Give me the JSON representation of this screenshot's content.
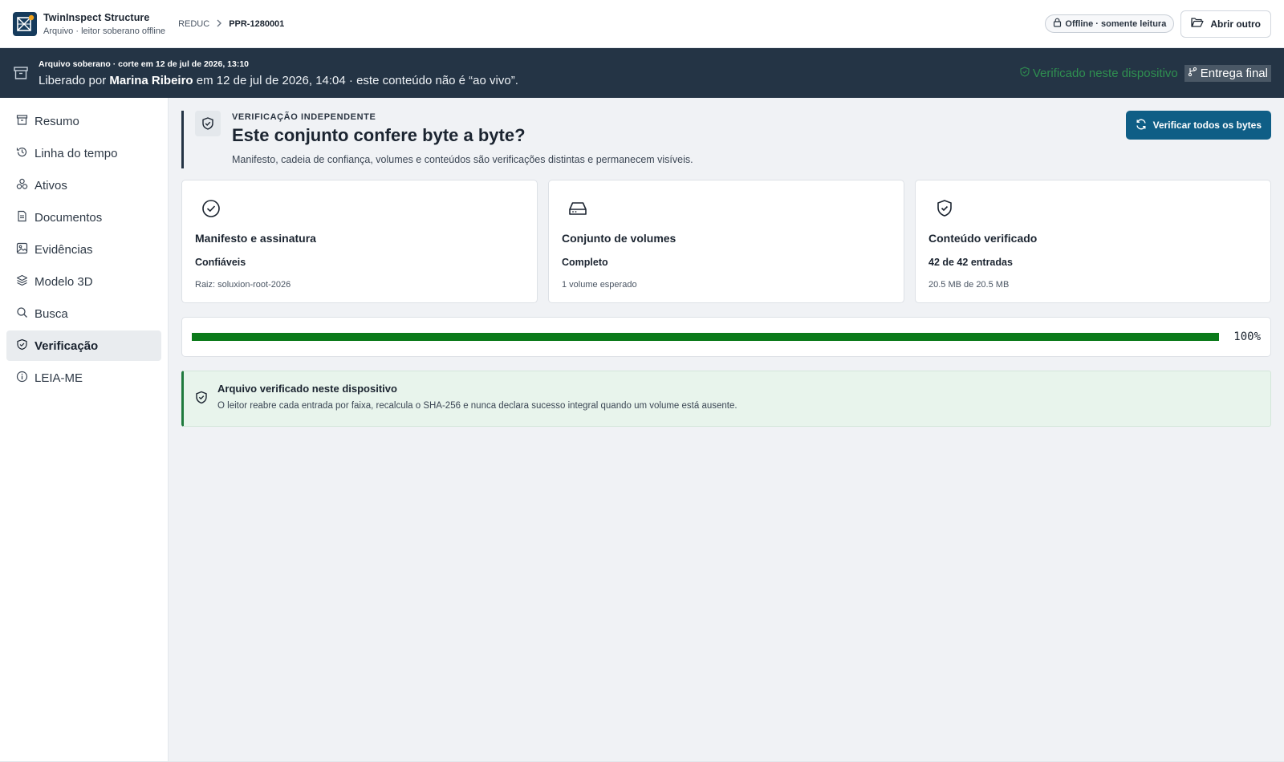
{
  "app": {
    "name": "TwinInspect  Structure",
    "subtitle": "Arquivo · leitor soberano offline",
    "logo_icon": "twininspect-logo",
    "logo_color": "#163b5c",
    "logo_accent": "#f2a31b"
  },
  "breadcrumb": {
    "root": "REDUC",
    "separator_icon": "chevron-right-icon",
    "current": "PPR-1280001"
  },
  "header_actions": {
    "offline_badge": "Offline · somente leitura",
    "offline_icon": "lock-icon",
    "open_other_label": "Abrir outro",
    "open_other_icon": "folder-open-icon"
  },
  "banner": {
    "icon": "archive-icon",
    "line1": "Arquivo soberano · corte em 12 de jul de 2026, 13:10",
    "released_prefix": "Liberado por",
    "released_by": "Marina Ribeiro",
    "released_suffix": "em 12 de jul de 2026, 14:04 · este conteúdo não é “ao vivo”.",
    "verified_label": "Verificado neste dispositivo",
    "verified_color": "#2f8f50",
    "final_label": "Entrega final",
    "final_icon": "git-branch-icon",
    "background": "#243445"
  },
  "sidebar": {
    "items": [
      {
        "label": "Resumo",
        "icon": "archive-icon",
        "active": false
      },
      {
        "label": "Linha do tempo",
        "icon": "history-icon",
        "active": false
      },
      {
        "label": "Ativos",
        "icon": "boxes-icon",
        "active": false
      },
      {
        "label": "Documentos",
        "icon": "document-icon",
        "active": false
      },
      {
        "label": "Evidências",
        "icon": "image-icon",
        "active": false
      },
      {
        "label": "Modelo 3D",
        "icon": "layers-icon",
        "active": false
      },
      {
        "label": "Busca",
        "icon": "search-icon",
        "active": false
      },
      {
        "label": "Verificação",
        "icon": "shield-check-icon",
        "active": true
      },
      {
        "label": "LEIA-ME",
        "icon": "info-icon",
        "active": false
      }
    ]
  },
  "verification": {
    "eyebrow": "VERIFICAÇÃO INDEPENDENTE",
    "title": "Este conjunto confere byte a byte?",
    "description": "Manifesto, cadeia de confiança, volumes e conteúdos são verificações distintas e permanecem visíveis.",
    "verify_button": "Verificar todos os bytes",
    "verify_button_icon": "refresh-icon",
    "primary_color": "#0f5e86",
    "cards": [
      {
        "icon": "check-circle-icon",
        "title": "Manifesto e assinatura",
        "status": "Confiáveis",
        "detail": "Raiz: soluxion-root-2026"
      },
      {
        "icon": "hard-drive-icon",
        "title": "Conjunto de volumes",
        "status": "Completo",
        "detail": "1 volume esperado"
      },
      {
        "icon": "shield-check-icon",
        "title": "Conteúdo verificado",
        "status": "42 de 42 entradas",
        "detail": "20.5 MB de 20.5 MB"
      }
    ],
    "progress": {
      "value": 1.0,
      "label": "100%",
      "color": "#0b7a1a"
    },
    "alert": {
      "icon": "shield-check-icon",
      "title": "Arquivo verificado neste dispositivo",
      "description": "O leitor reabre cada entrada por faixa, recalcula o SHA-256 e nunca declara sucesso integral quando um volume está ausente.",
      "color": "#1f7a3d"
    }
  }
}
